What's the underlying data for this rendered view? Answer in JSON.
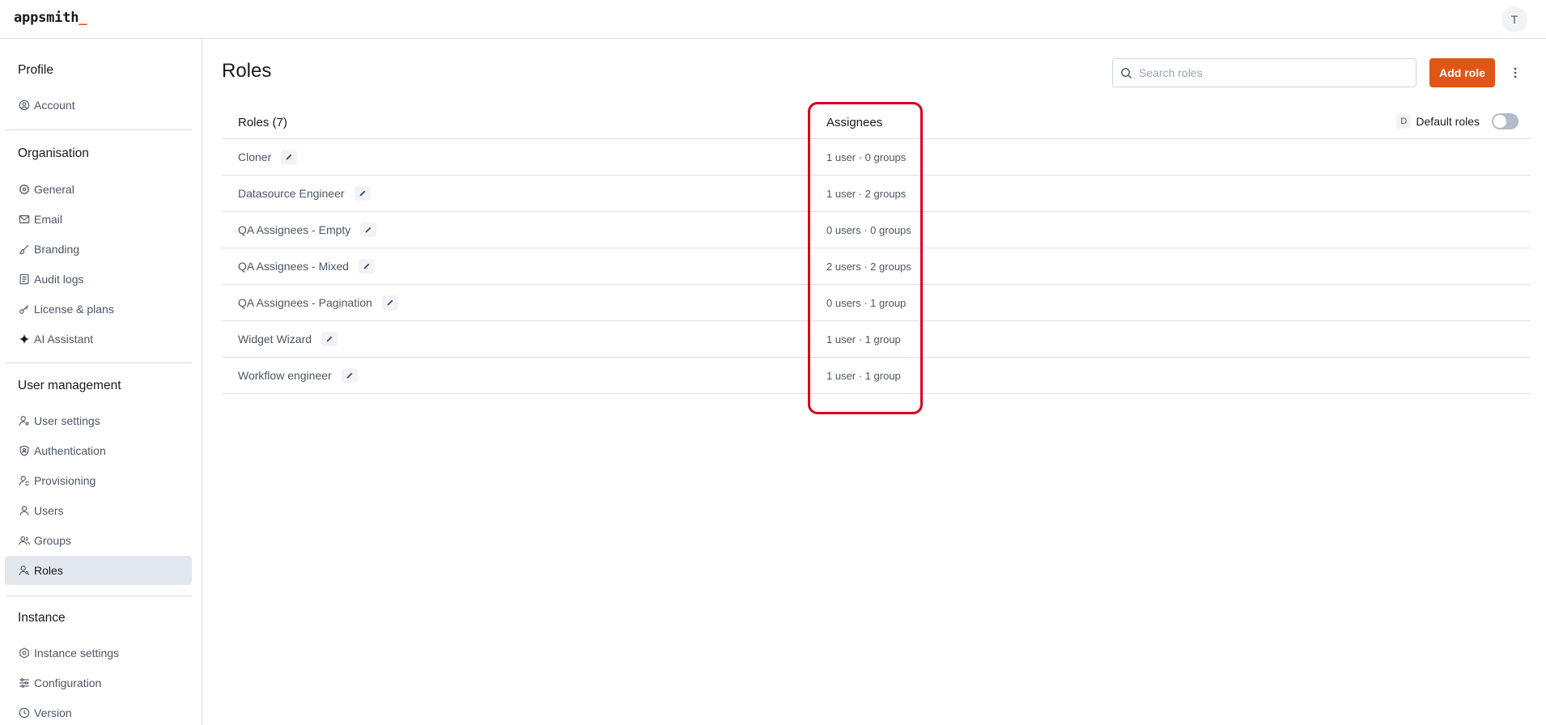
{
  "header": {
    "logo": "appsmith",
    "logo_cursor": "_",
    "avatar_initial": "T"
  },
  "sidebar": {
    "sections": [
      {
        "title": "Profile",
        "items": [
          {
            "label": "Account",
            "icon": "account-circle-icon"
          }
        ]
      },
      {
        "title": "Organisation",
        "items": [
          {
            "label": "General",
            "icon": "gear-icon"
          },
          {
            "label": "Email",
            "icon": "mail-icon"
          },
          {
            "label": "Branding",
            "icon": "brush-icon"
          },
          {
            "label": "Audit logs",
            "icon": "file-list-icon"
          },
          {
            "label": "License & plans",
            "icon": "key-icon"
          },
          {
            "label": "AI Assistant",
            "icon": "sparkle-icon"
          }
        ]
      },
      {
        "title": "User management",
        "items": [
          {
            "label": "User settings",
            "icon": "user-settings-icon"
          },
          {
            "label": "Authentication",
            "icon": "shield-user-icon"
          },
          {
            "label": "Provisioning",
            "icon": "user-sync-icon"
          },
          {
            "label": "Users",
            "icon": "user-icon"
          },
          {
            "label": "Groups",
            "icon": "group-icon"
          },
          {
            "label": "Roles",
            "icon": "user-key-icon",
            "active": true
          }
        ]
      },
      {
        "title": "Instance",
        "items": [
          {
            "label": "Instance settings",
            "icon": "settings-icon"
          },
          {
            "label": "Configuration",
            "icon": "sliders-icon"
          },
          {
            "label": "Version",
            "icon": "clock-icon"
          }
        ]
      }
    ]
  },
  "main": {
    "title": "Roles",
    "search": {
      "placeholder": "Search roles",
      "value": ""
    },
    "add_button_label": "Add role",
    "table": {
      "roles_header": "Roles (7)",
      "assignees_header": "Assignees",
      "default_badge": "D",
      "default_roles_label": "Default roles",
      "default_roles_enabled": false,
      "rows": [
        {
          "name": "Cloner",
          "assignees": "1 user · 0 groups"
        },
        {
          "name": "Datasource Engineer",
          "assignees": "1 user · 2 groups"
        },
        {
          "name": "QA Assignees - Empty",
          "assignees": "0 users · 0 groups"
        },
        {
          "name": "QA Assignees - Mixed",
          "assignees": "2 users · 2 groups"
        },
        {
          "name": "QA Assignees - Pagination",
          "assignees": "0 users · 1 group"
        },
        {
          "name": "Widget Wizard",
          "assignees": "1 user · 1 group"
        },
        {
          "name": "Workflow engineer",
          "assignees": "1 user · 1 group"
        }
      ]
    }
  },
  "colors": {
    "accent": "#e15615",
    "highlight": "#d9001c",
    "active_nav": "#e3e8ef"
  }
}
